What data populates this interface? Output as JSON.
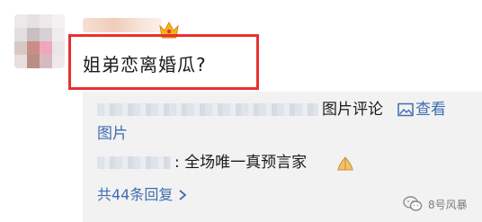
{
  "comment": {
    "text": "姐弟恋离婚瓜?"
  },
  "reply_panel": {
    "row1_label": "图片评论",
    "view_image_part1": "查看",
    "view_image_part2": "图片",
    "reply_text": ": 全场唯一真预言家",
    "more_replies_label": "共44条回复"
  },
  "watermark": {
    "text": "8号风暴"
  },
  "icons": {
    "avatar": "avatar",
    "crown": "crown-icon",
    "image": "image-icon",
    "hands": "folded-hands-icon",
    "chevron": "chevron-right-icon",
    "wechat": "wechat-icon"
  },
  "colors": {
    "highlight": "#e8312f",
    "link": "#3f6db0",
    "panel_bg": "#f2f2f2",
    "text": "#1a1a1a"
  }
}
